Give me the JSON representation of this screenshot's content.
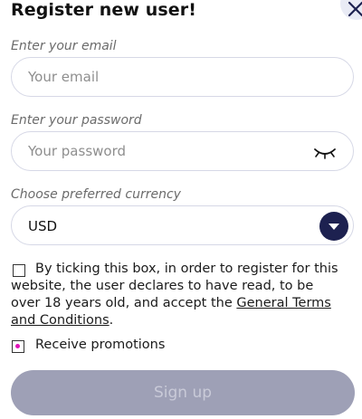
{
  "dialog": {
    "title": "Register new user!"
  },
  "email": {
    "label": "Enter your email",
    "placeholder": "Your email",
    "value": ""
  },
  "password": {
    "label": "Enter your password",
    "placeholder": "Your password",
    "value": "",
    "toggle_icon": "eye-closed-icon"
  },
  "currency": {
    "label": "Choose preferred currency",
    "selected": "USD"
  },
  "terms": {
    "checked": false,
    "text_before": "By ticking this box, in order to register for this website, the user declares to have read, to be over 18 years old, and accept the ",
    "link_text": "General Terms and Conditions",
    "text_after": "."
  },
  "promotions": {
    "checked": true,
    "label": "Receive promotions"
  },
  "signup": {
    "label": "Sign up"
  },
  "colors": {
    "accent_dark": "#1d2150",
    "checkbox_mark": "#e011b8",
    "button_disabled": "#9ea0b6"
  }
}
